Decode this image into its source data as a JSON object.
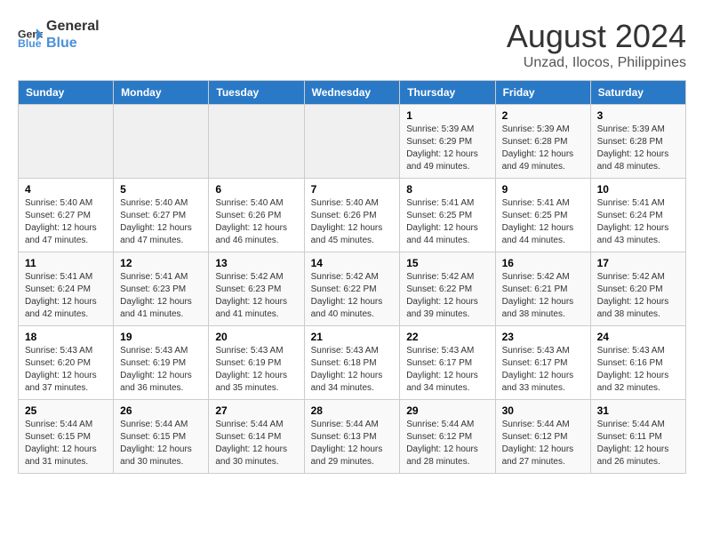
{
  "header": {
    "logo_line1": "General",
    "logo_line2": "Blue",
    "month_year": "August 2024",
    "location": "Unzad, Ilocos, Philippines"
  },
  "weekdays": [
    "Sunday",
    "Monday",
    "Tuesday",
    "Wednesday",
    "Thursday",
    "Friday",
    "Saturday"
  ],
  "weeks": [
    [
      {
        "day": "",
        "sunrise": "",
        "sunset": "",
        "daylight": ""
      },
      {
        "day": "",
        "sunrise": "",
        "sunset": "",
        "daylight": ""
      },
      {
        "day": "",
        "sunrise": "",
        "sunset": "",
        "daylight": ""
      },
      {
        "day": "",
        "sunrise": "",
        "sunset": "",
        "daylight": ""
      },
      {
        "day": "1",
        "sunrise": "Sunrise: 5:39 AM",
        "sunset": "Sunset: 6:29 PM",
        "daylight": "Daylight: 12 hours and 49 minutes."
      },
      {
        "day": "2",
        "sunrise": "Sunrise: 5:39 AM",
        "sunset": "Sunset: 6:28 PM",
        "daylight": "Daylight: 12 hours and 49 minutes."
      },
      {
        "day": "3",
        "sunrise": "Sunrise: 5:39 AM",
        "sunset": "Sunset: 6:28 PM",
        "daylight": "Daylight: 12 hours and 48 minutes."
      }
    ],
    [
      {
        "day": "4",
        "sunrise": "Sunrise: 5:40 AM",
        "sunset": "Sunset: 6:27 PM",
        "daylight": "Daylight: 12 hours and 47 minutes."
      },
      {
        "day": "5",
        "sunrise": "Sunrise: 5:40 AM",
        "sunset": "Sunset: 6:27 PM",
        "daylight": "Daylight: 12 hours and 47 minutes."
      },
      {
        "day": "6",
        "sunrise": "Sunrise: 5:40 AM",
        "sunset": "Sunset: 6:26 PM",
        "daylight": "Daylight: 12 hours and 46 minutes."
      },
      {
        "day": "7",
        "sunrise": "Sunrise: 5:40 AM",
        "sunset": "Sunset: 6:26 PM",
        "daylight": "Daylight: 12 hours and 45 minutes."
      },
      {
        "day": "8",
        "sunrise": "Sunrise: 5:41 AM",
        "sunset": "Sunset: 6:25 PM",
        "daylight": "Daylight: 12 hours and 44 minutes."
      },
      {
        "day": "9",
        "sunrise": "Sunrise: 5:41 AM",
        "sunset": "Sunset: 6:25 PM",
        "daylight": "Daylight: 12 hours and 44 minutes."
      },
      {
        "day": "10",
        "sunrise": "Sunrise: 5:41 AM",
        "sunset": "Sunset: 6:24 PM",
        "daylight": "Daylight: 12 hours and 43 minutes."
      }
    ],
    [
      {
        "day": "11",
        "sunrise": "Sunrise: 5:41 AM",
        "sunset": "Sunset: 6:24 PM",
        "daylight": "Daylight: 12 hours and 42 minutes."
      },
      {
        "day": "12",
        "sunrise": "Sunrise: 5:41 AM",
        "sunset": "Sunset: 6:23 PM",
        "daylight": "Daylight: 12 hours and 41 minutes."
      },
      {
        "day": "13",
        "sunrise": "Sunrise: 5:42 AM",
        "sunset": "Sunset: 6:23 PM",
        "daylight": "Daylight: 12 hours and 41 minutes."
      },
      {
        "day": "14",
        "sunrise": "Sunrise: 5:42 AM",
        "sunset": "Sunset: 6:22 PM",
        "daylight": "Daylight: 12 hours and 40 minutes."
      },
      {
        "day": "15",
        "sunrise": "Sunrise: 5:42 AM",
        "sunset": "Sunset: 6:22 PM",
        "daylight": "Daylight: 12 hours and 39 minutes."
      },
      {
        "day": "16",
        "sunrise": "Sunrise: 5:42 AM",
        "sunset": "Sunset: 6:21 PM",
        "daylight": "Daylight: 12 hours and 38 minutes."
      },
      {
        "day": "17",
        "sunrise": "Sunrise: 5:42 AM",
        "sunset": "Sunset: 6:20 PM",
        "daylight": "Daylight: 12 hours and 38 minutes."
      }
    ],
    [
      {
        "day": "18",
        "sunrise": "Sunrise: 5:43 AM",
        "sunset": "Sunset: 6:20 PM",
        "daylight": "Daylight: 12 hours and 37 minutes."
      },
      {
        "day": "19",
        "sunrise": "Sunrise: 5:43 AM",
        "sunset": "Sunset: 6:19 PM",
        "daylight": "Daylight: 12 hours and 36 minutes."
      },
      {
        "day": "20",
        "sunrise": "Sunrise: 5:43 AM",
        "sunset": "Sunset: 6:19 PM",
        "daylight": "Daylight: 12 hours and 35 minutes."
      },
      {
        "day": "21",
        "sunrise": "Sunrise: 5:43 AM",
        "sunset": "Sunset: 6:18 PM",
        "daylight": "Daylight: 12 hours and 34 minutes."
      },
      {
        "day": "22",
        "sunrise": "Sunrise: 5:43 AM",
        "sunset": "Sunset: 6:17 PM",
        "daylight": "Daylight: 12 hours and 34 minutes."
      },
      {
        "day": "23",
        "sunrise": "Sunrise: 5:43 AM",
        "sunset": "Sunset: 6:17 PM",
        "daylight": "Daylight: 12 hours and 33 minutes."
      },
      {
        "day": "24",
        "sunrise": "Sunrise: 5:43 AM",
        "sunset": "Sunset: 6:16 PM",
        "daylight": "Daylight: 12 hours and 32 minutes."
      }
    ],
    [
      {
        "day": "25",
        "sunrise": "Sunrise: 5:44 AM",
        "sunset": "Sunset: 6:15 PM",
        "daylight": "Daylight: 12 hours and 31 minutes."
      },
      {
        "day": "26",
        "sunrise": "Sunrise: 5:44 AM",
        "sunset": "Sunset: 6:15 PM",
        "daylight": "Daylight: 12 hours and 30 minutes."
      },
      {
        "day": "27",
        "sunrise": "Sunrise: 5:44 AM",
        "sunset": "Sunset: 6:14 PM",
        "daylight": "Daylight: 12 hours and 30 minutes."
      },
      {
        "day": "28",
        "sunrise": "Sunrise: 5:44 AM",
        "sunset": "Sunset: 6:13 PM",
        "daylight": "Daylight: 12 hours and 29 minutes."
      },
      {
        "day": "29",
        "sunrise": "Sunrise: 5:44 AM",
        "sunset": "Sunset: 6:12 PM",
        "daylight": "Daylight: 12 hours and 28 minutes."
      },
      {
        "day": "30",
        "sunrise": "Sunrise: 5:44 AM",
        "sunset": "Sunset: 6:12 PM",
        "daylight": "Daylight: 12 hours and 27 minutes."
      },
      {
        "day": "31",
        "sunrise": "Sunrise: 5:44 AM",
        "sunset": "Sunset: 6:11 PM",
        "daylight": "Daylight: 12 hours and 26 minutes."
      }
    ]
  ]
}
